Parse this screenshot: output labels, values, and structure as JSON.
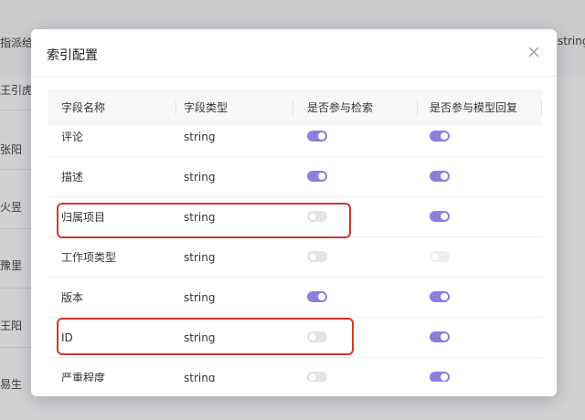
{
  "background": {
    "header_left": "指派给",
    "header_right": "string",
    "left_names": [
      "王引虎",
      "张阳",
      "火昱",
      "豫里",
      "王阳",
      "易生"
    ]
  },
  "modal": {
    "title": "索引配置",
    "close_icon": "close-icon",
    "columns": [
      "字段名称",
      "字段类型",
      "是否参与检索",
      "是否参与模型回复"
    ],
    "rows": [
      {
        "name": "评论",
        "type": "string",
        "search": true,
        "reply": true
      },
      {
        "name": "描述",
        "type": "string",
        "search": true,
        "reply": true
      },
      {
        "name": "归属项目",
        "type": "string",
        "search": false,
        "reply": true
      },
      {
        "name": "工作项类型",
        "type": "string",
        "search": false,
        "reply": false
      },
      {
        "name": "版本",
        "type": "string",
        "search": true,
        "reply": true
      },
      {
        "name": "ID",
        "type": "string",
        "search": false,
        "reply": true
      },
      {
        "name": "严重程度",
        "type": "string",
        "search": false,
        "reply": true
      }
    ]
  },
  "colors": {
    "toggle_on": "#8b7fdc",
    "toggle_off": "#e4e4e7",
    "highlight": "#d4352f"
  }
}
